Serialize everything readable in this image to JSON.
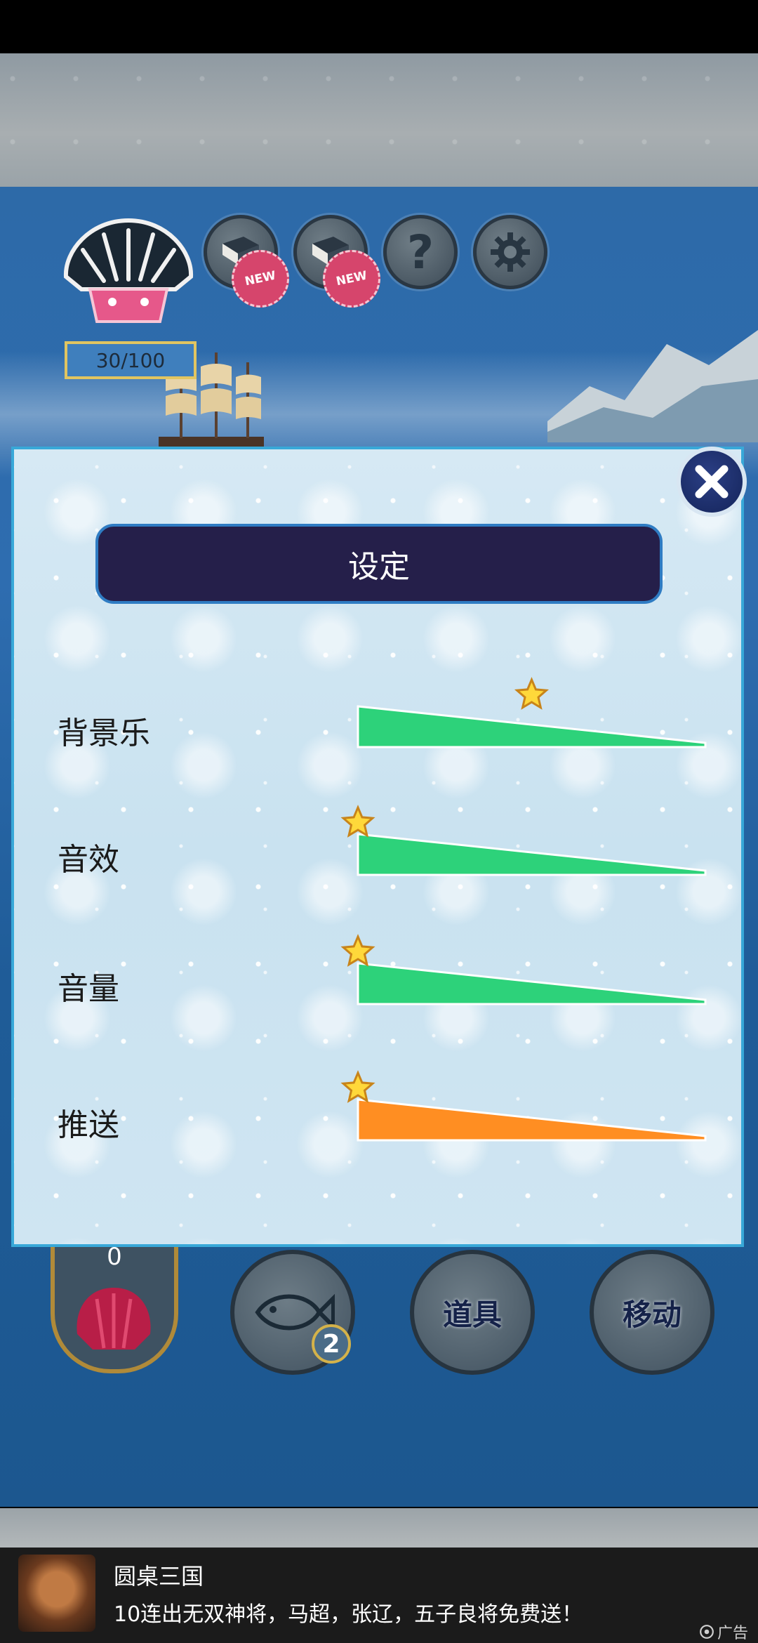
{
  "hud": {
    "progress_text": "30/100",
    "new_badge_1": "NEW",
    "new_badge_2": "NEW",
    "help_glyph": "?",
    "icons": [
      "book-icon",
      "book-icon",
      "help-icon",
      "gear-icon"
    ]
  },
  "dialog": {
    "title": "设定",
    "rows": [
      {
        "label": "背景乐",
        "level": 0.5,
        "color": "#2dd27a"
      },
      {
        "label": "音效",
        "level": 0.0,
        "color": "#2dd27a"
      },
      {
        "label": "音量",
        "level": 0.0,
        "color": "#2dd27a"
      },
      {
        "label": "推送",
        "level": 0.0,
        "color": "#ff8e22"
      }
    ]
  },
  "bottom_hud": {
    "shell_count": "0",
    "fish_count": "2",
    "items_label": "道具",
    "move_label": "移动"
  },
  "ad": {
    "title": "圆桌三国",
    "description": "10连出无双神将，马超，张辽，五子良将免费送！",
    "tag": "广告"
  },
  "colors": {
    "accent_blue": "#38a8d8",
    "title_bar": "#251f4a",
    "slider_green": "#2dd27a",
    "slider_orange": "#ff8e22",
    "badge_pink": "#d6456c"
  }
}
